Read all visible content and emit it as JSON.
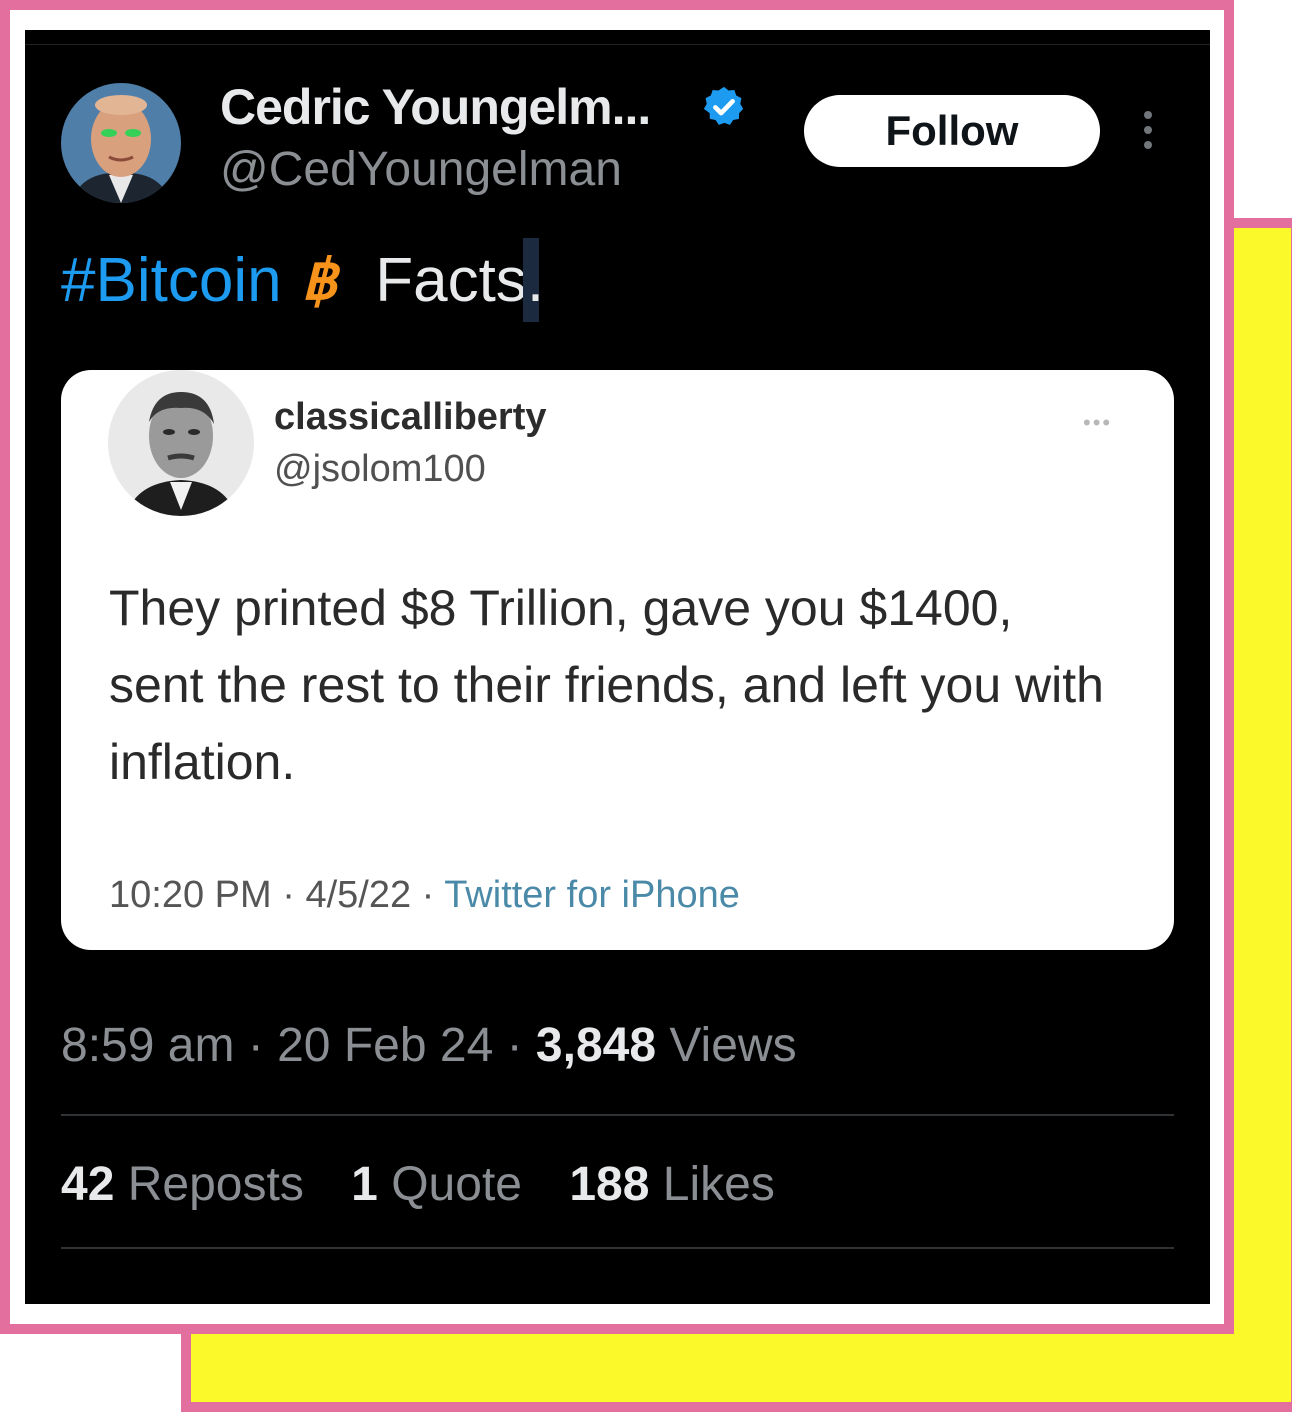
{
  "author": {
    "display_name": "Cedric Youngelm...",
    "handle": "@CedYoungelman",
    "verified": true
  },
  "header": {
    "follow_label": "Follow"
  },
  "tweet": {
    "hashtag": "#Bitcoin",
    "bitcoin_symbol": "฿",
    "text": "Facts",
    "text_end": "."
  },
  "quoted": {
    "name": "classicalliberty",
    "handle": "@jsolom100",
    "more": "•••",
    "body": "They printed $8 Trillion, gave you $1400, sent the rest to their friends, and left you with inflation.",
    "time": "10:20 PM",
    "date": "4/5/22",
    "source": "Twitter for iPhone"
  },
  "meta": {
    "time": "8:59 am",
    "date": "20 Feb 24",
    "views_count": "3,848",
    "views_label": "Views"
  },
  "stats": {
    "reposts_count": "42",
    "reposts_label": "Reposts",
    "quotes_count": "1",
    "quotes_label": "Quote",
    "likes_count": "188",
    "likes_label": "Likes"
  },
  "colors": {
    "border_pink": "#e36f9e",
    "accent_yellow": "#fcf92a",
    "link_blue": "#1d9bf0",
    "bitcoin_orange": "#f7931a"
  }
}
